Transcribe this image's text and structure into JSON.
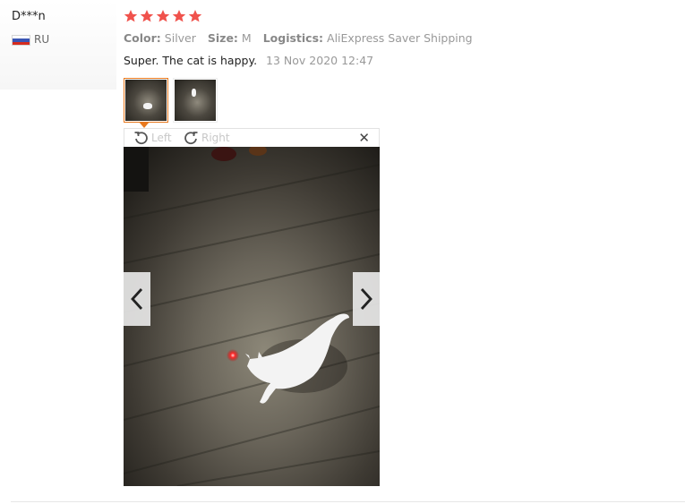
{
  "review": {
    "user_name": "D***n",
    "country": "RU",
    "rating": 5,
    "rating_color": "#f0524c",
    "color_label": "Color:",
    "color_value": "Silver",
    "size_label": "Size:",
    "size_value": "M",
    "logistics_label": "Logistics:",
    "logistics_value": "AliExpress Saver Shipping",
    "comment": "Super. The cat is happy.",
    "date": "13 Nov 2020 12:47"
  },
  "viewer": {
    "rotate_left_label": "Left",
    "rotate_right_label": "Right",
    "close_icon": "close-icon",
    "selected_thumbnail": 1,
    "thumbnail_count": 2
  },
  "colors": {
    "accent": "#e8791e",
    "muted_label": "#888888",
    "muted_value": "#999999"
  }
}
